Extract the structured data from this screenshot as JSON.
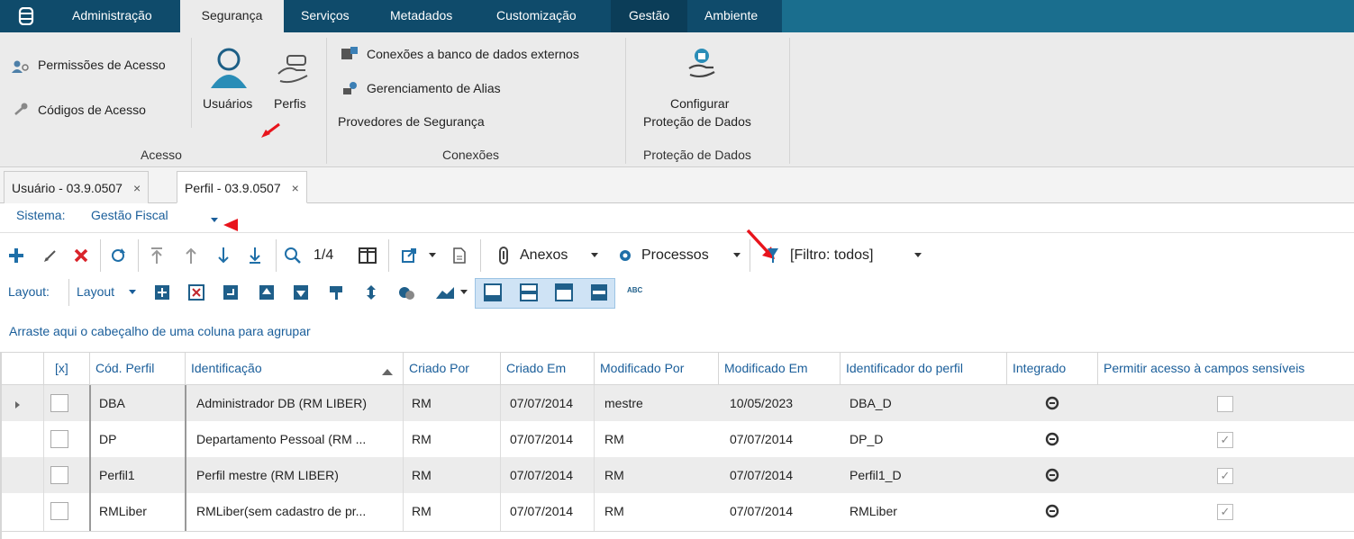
{
  "menu": {
    "logo_icon": "app-logo-icon",
    "tabs": [
      "Administração",
      "Segurança",
      "Serviços",
      "Metadados",
      "Customização",
      "Gestão",
      "Ambiente"
    ],
    "active": "Segurança"
  },
  "ribbon": {
    "acesso": {
      "items": [
        "Permissões de Acesso",
        "Códigos de Acesso"
      ],
      "big": [
        "Usuários",
        "Perfis"
      ],
      "group_label": "Acesso"
    },
    "conexoes": {
      "items": [
        "Conexões a banco de dados externos",
        "Gerenciamento de Alias",
        "Provedores de Segurança"
      ],
      "group_label": "Conexões"
    },
    "protecao": {
      "line1": "Configurar",
      "line2": "Proteção de Dados",
      "group_label": "Proteção de Dados"
    }
  },
  "doc_tabs": [
    {
      "label": "Usuário - 03.9.0507",
      "close": "×"
    },
    {
      "label": "Perfil - 03.9.0507",
      "close": "×"
    }
  ],
  "sistema": {
    "label": "Sistema:",
    "value": "Gestão Fiscal"
  },
  "toolbar": {
    "page": "1/4",
    "anexos": "Anexos",
    "processos": "Processos",
    "filtro": "[Filtro: todos]"
  },
  "layout_bar": {
    "label": "Layout:",
    "dropdown": "Layout",
    "abc": "ABC"
  },
  "group_hint": "Arraste aqui o cabeçalho de uma coluna para agrupar",
  "columns": [
    "[x]",
    "Cód. Perfil",
    "Identificação",
    "Criado Por",
    "Criado Em",
    "Modificado Por",
    "Modificado Em",
    "Identificador do perfil",
    "Integrado",
    "Permitir acesso à campos sensíveis"
  ],
  "rows": [
    {
      "cod": "DBA",
      "ident": "Administrador DB (RM LIBER)",
      "criado_por": "RM",
      "criado_em": "07/07/2014",
      "mod_por": "mestre",
      "mod_em": "10/05/2023",
      "id_perfil": "DBA_D",
      "sensiveis": false
    },
    {
      "cod": "DP",
      "ident": "Departamento Pessoal (RM ...",
      "criado_por": "RM",
      "criado_em": "07/07/2014",
      "mod_por": "RM",
      "mod_em": "07/07/2014",
      "id_perfil": "DP_D",
      "sensiveis": true
    },
    {
      "cod": "Perfil1",
      "ident": "Perfil mestre (RM LIBER)",
      "criado_por": "RM",
      "criado_em": "07/07/2014",
      "mod_por": "RM",
      "mod_em": "07/07/2014",
      "id_perfil": "Perfil1_D",
      "sensiveis": true
    },
    {
      "cod": "RMLiber",
      "ident": "RMLiber(sem cadastro de pr...",
      "criado_por": "RM",
      "criado_em": "07/07/2014",
      "mod_por": "RM",
      "mod_em": "07/07/2014",
      "id_perfil": "RMLiber",
      "sensiveis": true
    }
  ],
  "colors": {
    "menu_bg": "#1a6e8e",
    "menu_dark": "#0f4b6b",
    "accent": "#1a5e9a",
    "annotation": "#e8141c"
  }
}
